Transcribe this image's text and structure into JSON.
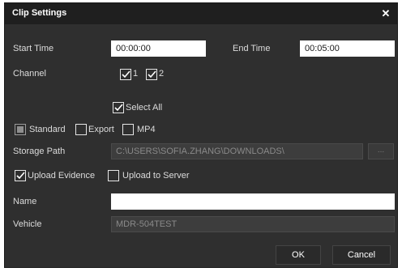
{
  "dialog": {
    "title": "Clip Settings",
    "close_glyph": "✕"
  },
  "time": {
    "start_label": "Start Time",
    "start_value": "00:00:00",
    "end_label": "End Time",
    "end_value": "00:05:00"
  },
  "channel": {
    "label": "Channel",
    "options": [
      {
        "label": "1",
        "checked": true
      },
      {
        "label": "2",
        "checked": true
      }
    ],
    "select_all_label": "Select All",
    "select_all_checked": true
  },
  "format": {
    "standard_label": "Standard",
    "standard_checked": true,
    "export_label": "Export",
    "export_checked": false,
    "mp4_label": "MP4",
    "mp4_checked": false
  },
  "storage": {
    "label": "Storage Path",
    "value": "C:\\USERS\\SOFIA.ZHANG\\DOWNLOADS\\",
    "browse_label": "..."
  },
  "upload": {
    "evidence_label": "Upload Evidence",
    "evidence_checked": true,
    "server_label": "Upload to Server",
    "server_checked": false
  },
  "name": {
    "label": "Name",
    "value": ""
  },
  "vehicle": {
    "label": "Vehicle",
    "value": "MDR-504TEST"
  },
  "buttons": {
    "ok_label": "OK",
    "cancel_label": "Cancel"
  },
  "colors": {
    "dialog_bg": "#2f2f2f",
    "titlebar_bg": "#1f1f1f",
    "text": "#dcdcdc"
  }
}
